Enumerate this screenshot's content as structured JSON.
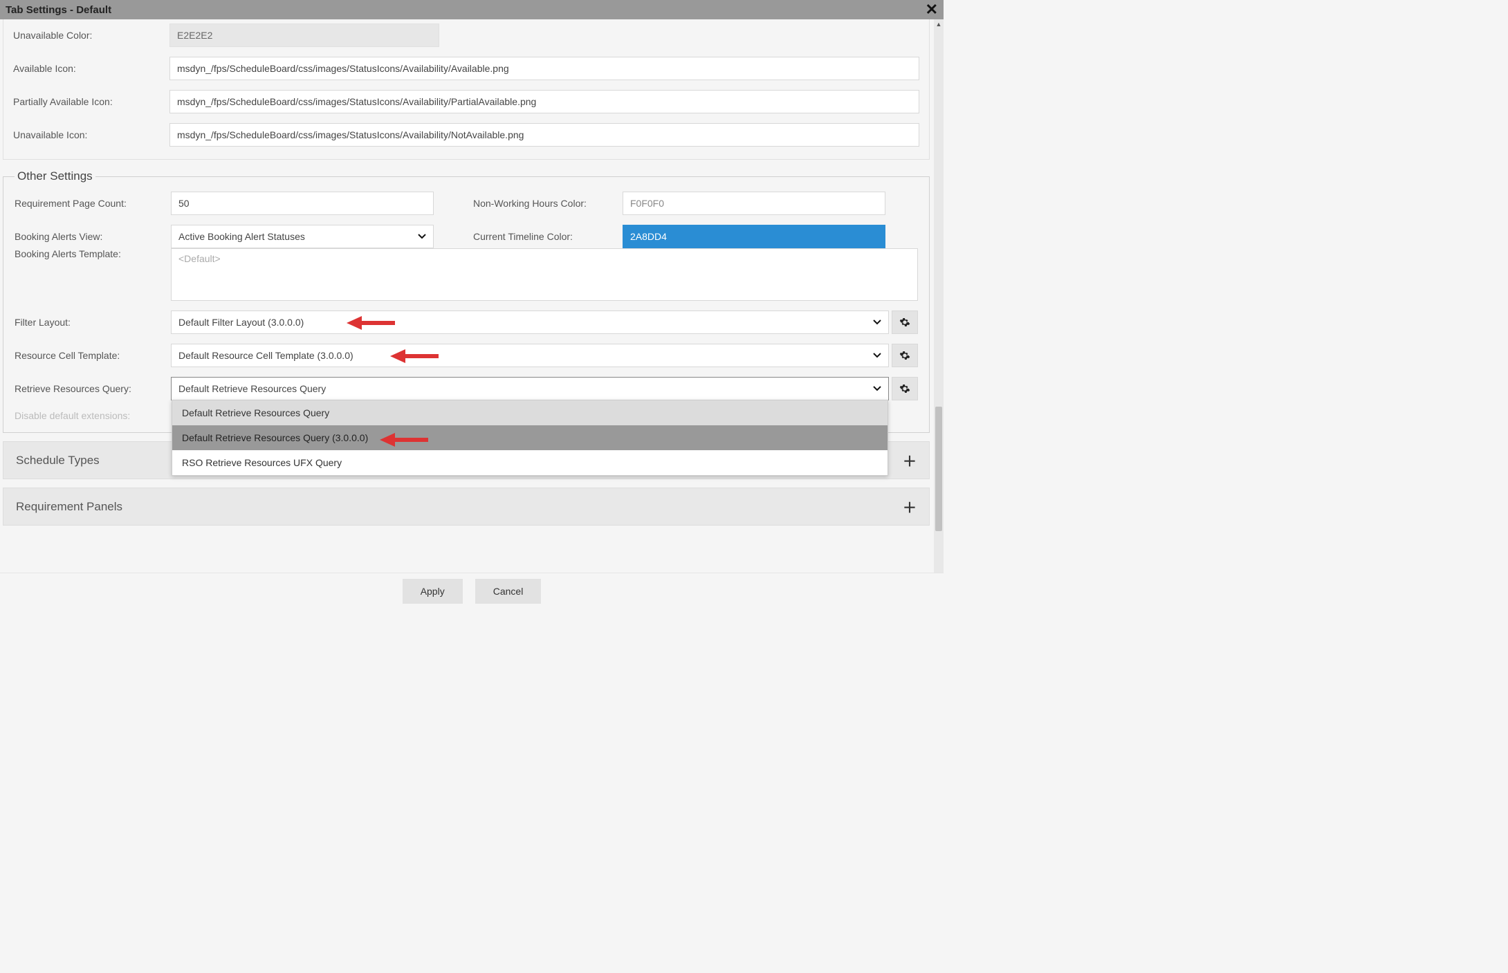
{
  "title": "Tab Settings - Default",
  "top": {
    "unavailable_color_label": "Unavailable Color:",
    "unavailable_color_value": "E2E2E2",
    "available_icon_label": "Available Icon:",
    "available_icon_value": "msdyn_/fps/ScheduleBoard/css/images/StatusIcons/Availability/Available.png",
    "partially_icon_label": "Partially Available Icon:",
    "partially_icon_value": "msdyn_/fps/ScheduleBoard/css/images/StatusIcons/Availability/PartialAvailable.png",
    "unavailable_icon_label": "Unavailable Icon:",
    "unavailable_icon_value": "msdyn_/fps/ScheduleBoard/css/images/StatusIcons/Availability/NotAvailable.png"
  },
  "other": {
    "legend": "Other Settings",
    "req_page_count_label": "Requirement Page Count:",
    "req_page_count_value": "50",
    "nonworking_label": "Non-Working Hours Color:",
    "nonworking_value": "F0F0F0",
    "alerts_view_label": "Booking Alerts View:",
    "alerts_view_value": "Active Booking Alert Statuses",
    "timeline_label": "Current Timeline Color:",
    "timeline_value": "2A8DD4",
    "alerts_template_label": "Booking Alerts Template:",
    "alerts_template_placeholder": "<Default>",
    "filter_layout_label": "Filter Layout:",
    "filter_layout_value": "Default Filter Layout (3.0.0.0)",
    "resource_cell_label": "Resource Cell Template:",
    "resource_cell_value": "Default Resource Cell Template (3.0.0.0)",
    "retrieve_label": "Retrieve Resources Query:",
    "retrieve_value": "Default Retrieve Resources Query",
    "retrieve_options": [
      "Default Retrieve Resources Query",
      "Default Retrieve Resources Query (3.0.0.0)",
      "RSO Retrieve Resources UFX Query"
    ],
    "disable_ext_label": "Disable default extensions:"
  },
  "sections": {
    "schedule_types": "Schedule Types",
    "requirement_panels": "Requirement Panels"
  },
  "footer": {
    "apply": "Apply",
    "cancel": "Cancel"
  }
}
